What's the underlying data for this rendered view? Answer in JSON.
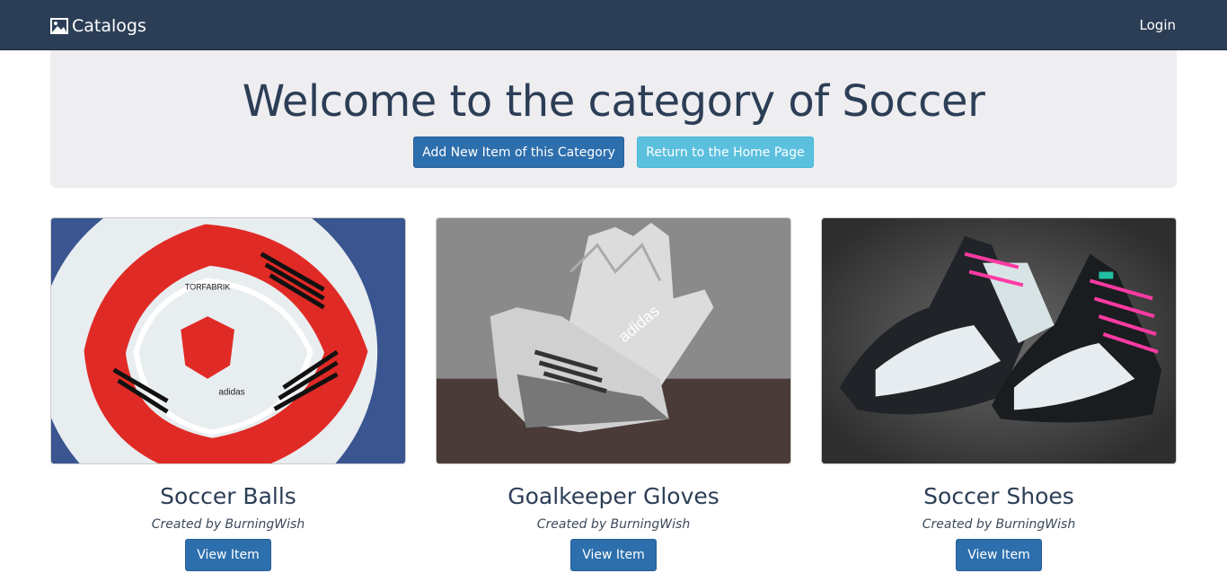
{
  "navbar": {
    "brand_label": "Catalogs",
    "brand_icon": "picture-icon",
    "login_label": "Login"
  },
  "jumbotron": {
    "title": "Welcome to the category of Soccer",
    "add_button_label": "Add New Item of this Category",
    "home_button_label": "Return to the Home Page"
  },
  "items": [
    {
      "title": "Soccer Balls",
      "author": "Created by BurningWish",
      "button_label": "View Item",
      "image": "soccer-ball-photo"
    },
    {
      "title": "Goalkeeper Gloves",
      "author": "Created by BurningWish",
      "button_label": "View Item",
      "image": "goalkeeper-gloves-photo"
    },
    {
      "title": "Soccer Shoes",
      "author": "Created by BurningWish",
      "button_label": "View Item",
      "image": "soccer-shoes-photo"
    }
  ],
  "colors": {
    "navbar": "#2c3e56",
    "jumbotron": "#eeedf0",
    "primary": "#2d6fad",
    "info": "#5bc0de"
  }
}
